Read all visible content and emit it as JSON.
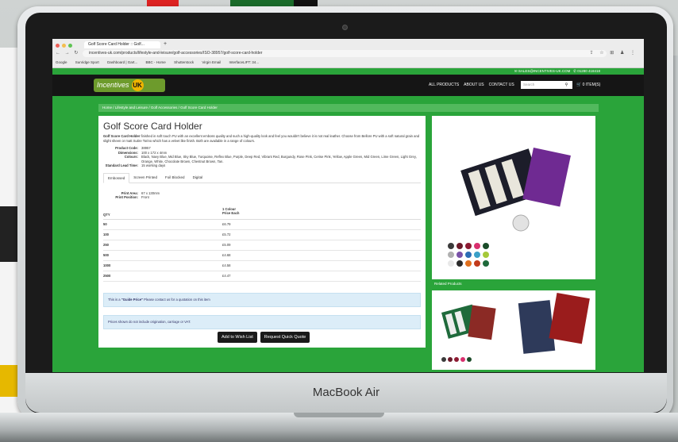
{
  "browser": {
    "tab_title": "Golf Score Card Holder :: Golf...",
    "new_tab": "+",
    "url": "incentives-uk.com/products/lifestyle-and-leisure/golf-accessories/ISO-38957/golf-score-card-holder",
    "bookmarks": [
      "Google",
      "Sunridge Sport",
      "Dashboard | Gart...",
      "BBC - Home",
      "Shutterstock",
      "Virgin Email",
      "InterfaceLIFT: 34..."
    ]
  },
  "topbar": {
    "email": "SALES@INCENTIVES-UK.COM",
    "phone": "01280 418418"
  },
  "header": {
    "logo": "Incentives",
    "logo_badge": "UK",
    "menu": [
      "ALL PRODUCTS",
      "ABOUT US",
      "CONTACT US"
    ],
    "search_placeholder": "Search",
    "cart": "0 ITEM(S)"
  },
  "breadcrumb": [
    "Home",
    "Lifestyle and Leisure",
    "Golf Accessories",
    "Golf Score Card Holder"
  ],
  "product": {
    "title": "Golf Score Card Holder",
    "desc_bold": "Golf Score Card Holder",
    "desc": " finished in soft touch PU with an excellent emboss quality and such a high-quality look and feel you wouldn't believe it is not real leather. Choose from Bellore PU with a soft natural grain and slight sheen or matt Sutire Torino which has a velvet like finish. Both are available in a range of colours.",
    "specs": [
      {
        "k": "Product Code:",
        "v": "38957"
      },
      {
        "k": "Dimensions:",
        "v": "100 x 172 x 4mm"
      },
      {
        "k": "Colours:",
        "v": "Black, Navy Blue, Mid Blue, Sky Blue, Turquoise, Reflex Blue, Purple, Deep Red, Vibrant Red, Burgundy, Rose Pink, Cerise Pink, Yellow, Apple Green, Mid Green, Lime Green, Light Grey, Orange, White, Chocolate Brown, Chestnut Brown, Tan."
      },
      {
        "k": "Standard Lead Time:",
        "v": "15 working days"
      }
    ],
    "tabs": [
      "Embossed",
      "Screen Printed",
      "Foil Blocked",
      "Digital"
    ],
    "print": [
      {
        "k": "Print Area:",
        "v": "67 x 130mm"
      },
      {
        "k": "Print Position:",
        "v": "Front"
      }
    ],
    "qty_label": "QTY",
    "price_label_1": "1 Colour",
    "price_label_2": "Price Each",
    "prices": [
      {
        "q": "50",
        "p": "£6.79"
      },
      {
        "q": "100",
        "p": "£5.72"
      },
      {
        "q": "250",
        "p": "£5.09"
      },
      {
        "q": "500",
        "p": "£4.68"
      },
      {
        "q": "1000",
        "p": "£4.58"
      },
      {
        "q": "2500",
        "p": "£4.47"
      }
    ],
    "guide_note_pre": "This is a ",
    "guide_note_bold": "\"Guide Price\"",
    "guide_note_post": " Please contact us for a quotation on this item",
    "price_note": "Prices shown do not include origination, carriage or VAT.",
    "wishlist": "Add to Wish List",
    "quote": "Request Quick Quote"
  },
  "related": {
    "label": "Related Products"
  },
  "laptop": {
    "brand": "MacBook Air"
  },
  "colors": {
    "swatches": [
      "#3a3a3a",
      "#6b1b2a",
      "#8d1a32",
      "#d9306f",
      "#1b4c29",
      "#b0b0b0",
      "#7a52a8",
      "#2c6db5",
      "#3aa0c8",
      "#a5c93a",
      "#e8e8e8",
      "#2a2a2a",
      "#e0701e",
      "#c23b1c",
      "#1f6a3b"
    ]
  }
}
